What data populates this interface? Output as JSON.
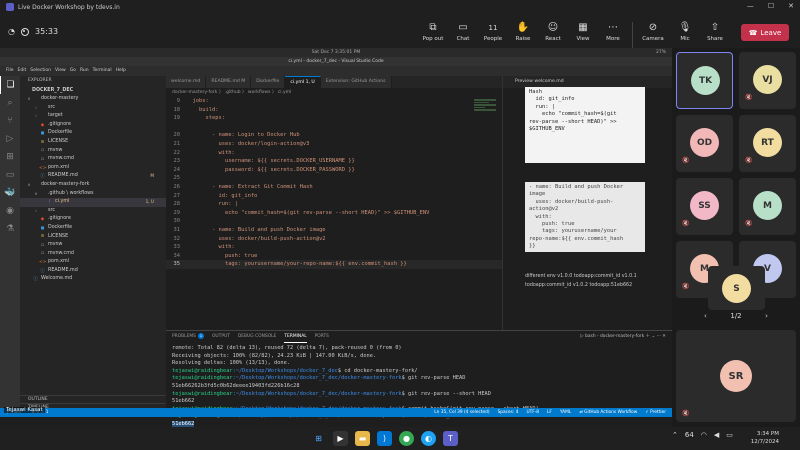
{
  "teams": {
    "title": "Live Docker Workshop by tdevs.in",
    "timer": "35:33",
    "tools": [
      {
        "label": "Pop out",
        "icon": "⧉"
      },
      {
        "label": "Chat",
        "icon": "💬"
      },
      {
        "label": "People",
        "icon": "👥",
        "count": "11"
      },
      {
        "label": "Raise",
        "icon": "✋"
      },
      {
        "label": "React",
        "icon": "☺"
      },
      {
        "label": "View",
        "icon": "▦"
      },
      {
        "label": "More",
        "icon": "⋯"
      }
    ],
    "camera_label": "Camera",
    "mic_label": "Mic",
    "share_label": "Share",
    "leave_label": "Leave"
  },
  "screen": {
    "mac_time": "Sat Dec 7  3:35:01 PM",
    "mac_battery": "27%",
    "vscode_title": "ci.yml - docker_7_dec - Visual Studio Code",
    "menu": [
      "File",
      "Edit",
      "Selection",
      "View",
      "Go",
      "Run",
      "Terminal",
      "Help"
    ],
    "explorer_label": "EXPLORER",
    "project": "DOCKER_7_DEC",
    "tree": [
      {
        "indent": 0,
        "chev": "∨",
        "name": "docker-mastery",
        "icon": "folder"
      },
      {
        "indent": 1,
        "chev": "›",
        "name": "src",
        "icon": "folder"
      },
      {
        "indent": 1,
        "chev": "›",
        "name": "target",
        "icon": "folder"
      },
      {
        "indent": 1,
        "chev": "",
        "name": ".gitignore",
        "icon": "git"
      },
      {
        "indent": 1,
        "chev": "",
        "name": "Dockerfile",
        "icon": "docker"
      },
      {
        "indent": 1,
        "chev": "",
        "name": "LICENSE",
        "icon": "license"
      },
      {
        "indent": 1,
        "chev": "",
        "name": "mvnw",
        "icon": "file"
      },
      {
        "indent": 1,
        "chev": "",
        "name": "mvnw.cmd",
        "icon": "file"
      },
      {
        "indent": 1,
        "chev": "",
        "name": "pom.xml",
        "icon": "xml"
      },
      {
        "indent": 1,
        "chev": "",
        "name": "README.md",
        "icon": "md",
        "badge": "M"
      },
      {
        "indent": 0,
        "chev": "∨",
        "name": "docker-mastery-fork",
        "icon": "folder"
      },
      {
        "indent": 1,
        "chev": "∨",
        "name": ".github \\ workflows",
        "icon": "folder"
      },
      {
        "indent": 2,
        "chev": "",
        "name": "ci.yml",
        "icon": "yml",
        "badge": "1, U",
        "selected": true
      },
      {
        "indent": 1,
        "chev": "›",
        "name": "src",
        "icon": "folder"
      },
      {
        "indent": 1,
        "chev": "",
        "name": ".gitignore",
        "icon": "git"
      },
      {
        "indent": 1,
        "chev": "",
        "name": "Dockerfile",
        "icon": "docker"
      },
      {
        "indent": 1,
        "chev": "",
        "name": "LICENSE",
        "icon": "license"
      },
      {
        "indent": 1,
        "chev": "",
        "name": "mvnw",
        "icon": "file"
      },
      {
        "indent": 1,
        "chev": "",
        "name": "mvnw.cmd",
        "icon": "file"
      },
      {
        "indent": 1,
        "chev": "",
        "name": "pom.xml",
        "icon": "xml"
      },
      {
        "indent": 1,
        "chev": "",
        "name": "README.md",
        "icon": "md"
      },
      {
        "indent": 0,
        "chev": "",
        "name": "Welcome.md",
        "icon": "md"
      }
    ],
    "outline_label": "OUTLINE",
    "timeline_label": "TIMELINE",
    "tabs": [
      {
        "name": "welcome.md",
        "active": false
      },
      {
        "name": "README.md M",
        "active": false
      },
      {
        "name": "Dockerfile",
        "active": false
      },
      {
        "name": "ci.yml 1, U",
        "active": true
      },
      {
        "name": "Extension: GitHub Actions",
        "active": false
      }
    ],
    "breadcrumb": "docker-mastery-fork 〉 .github 〉 workflows 〉 ci.yml",
    "code": [
      {
        "n": "9",
        "t": "  jobs:"
      },
      {
        "n": "18",
        "t": "    build:"
      },
      {
        "n": "19",
        "t": "      steps:"
      },
      {
        "n": "",
        "t": ""
      },
      {
        "n": "20",
        "t": "        - name: Login to Docker Hub"
      },
      {
        "n": "21",
        "t": "          uses: docker/login-action@v3"
      },
      {
        "n": "22",
        "t": "          with:"
      },
      {
        "n": "23",
        "t": "            username: ${{ secrets.DOCKER_USERNAME }}"
      },
      {
        "n": "24",
        "t": "            password: ${{ secrets.DOCKER_PASSWORD }}"
      },
      {
        "n": "25",
        "t": ""
      },
      {
        "n": "26",
        "t": "        - name: Extract Git Commit Hash"
      },
      {
        "n": "27",
        "t": "          id: git_info"
      },
      {
        "n": "28",
        "t": "          run: |"
      },
      {
        "n": "29",
        "t": "            echo \"commit_hash=$(git rev-parse --short HEAD)\" >> $GITHUB_ENV"
      },
      {
        "n": "30",
        "t": ""
      },
      {
        "n": "31",
        "t": "        - name: Build and push Docker image"
      },
      {
        "n": "32",
        "t": "          uses: docker/build-push-action@v2"
      },
      {
        "n": "33",
        "t": "          with:"
      },
      {
        "n": "34",
        "t": "            push: true"
      },
      {
        "n": "35",
        "t": "            tags: yourusername/your-repo-name:${{ env.commit_hash }}",
        "current": true
      }
    ],
    "preview_tab": "Preview welcome.md",
    "preview_code1": "Hash\n  id: git_info\n  run: |\n    echo \"commit_hash=$(git\nrev-parse --short HEAD)\" >>\n$GITHUB_ENV",
    "preview_code2": "- name: Build and push Docker\nimage\n  uses: docker/build-push-\naction@v2\n  with:\n    push: true\n    tags: yourusername/your\nrepo-name:${{ env.commit_hash\n}}",
    "preview_text": "different env v1.0.0 todoapp:commit_id v1.0.1 todoapp:commit_id v1.0.2 todoapp:51eb662",
    "panel_tabs": [
      "PROBLEMS",
      "OUTPUT",
      "DEBUG CONSOLE",
      "TERMINAL",
      "PORTS"
    ],
    "problems_count": "1",
    "terminal_name": "bash - docker-mastery-fork",
    "terminal": [
      {
        "t": "remote: Total 82 (delta 13), reused 72 (delta 7), pack-reused 0 (from 0)"
      },
      {
        "t": "Receiving objects: 100% (82/82), 24.23 KiB | 147.00 KiB/s, done."
      },
      {
        "t": "Resolving deltas: 100% (13/13), done."
      },
      {
        "p": "tejaswi@raidingbear",
        "path": ":~/Desktop/Workshops/docker_7_dec",
        "cmd": "$ cd docker-mastery-fork/"
      },
      {
        "p": "tejaswi@raidingbear",
        "path": ":~/Desktop/Workshops/docker_7_dec/docker-mastery-fork",
        "cmd": "$ git rev-parse HEAD"
      },
      {
        "t": "51eb66262b3fd5c0b62deeee19403fd226b16c28"
      },
      {
        "p": "tejaswi@raidingbear",
        "path": ":~/Desktop/Workshops/docker_7_dec/docker-mastery-fork",
        "cmd": "$ git rev-parse --short HEAD"
      },
      {
        "t": "51eb662"
      },
      {
        "p": "tejaswi@raidingbear",
        "path": ":~/Desktop/Workshops/docker_7_dec/docker-mastery-fork",
        "cmd": "$ commit_hash=$(git rev-parse --short HEAD)"
      },
      {
        "p": "tejaswi@raidingbear",
        "path": ":~/Desktop/Workshops/docker_7_dec/docker-mastery-fork",
        "cmd": "$ echo $commit_hash"
      },
      {
        "t": "51eb662",
        "highlight": true
      }
    ],
    "status_left": [
      "⚲ main*",
      "⊗ 0 ⚠ 1"
    ],
    "status_right": [
      "Ln 35, Col 39 (4 selected)",
      "Spaces: 4",
      "UTF-8",
      "LF",
      "YAML",
      "⇄ GitHub Actions Workflow",
      "✓ Prettier"
    ]
  },
  "presenter_caption": "Tejaswi Kasat",
  "participants": [
    {
      "initials": "TK",
      "color": "#b8e0c8",
      "selected": true
    },
    {
      "initials": "VJ",
      "color": "#e8dfa0"
    },
    {
      "initials": "OD",
      "color": "#f2b8b8"
    },
    {
      "initials": "RT",
      "color": "#f2dca0"
    },
    {
      "initials": "SS",
      "color": "#f2b8c8"
    },
    {
      "initials": "M",
      "color": "#b8e0c8"
    },
    {
      "initials": "M",
      "color": "#f2c0b0"
    },
    {
      "initials": "V",
      "color": "#c0c8f0"
    },
    {
      "initials": "S",
      "color": "#f2dca0"
    }
  ],
  "pager": "1/2",
  "big_participant": {
    "initials": "SR",
    "color": "#f2c0b0"
  },
  "taskbar": {
    "tray_count": "64",
    "time": "3:34 PM",
    "date": "12/7/2024"
  }
}
